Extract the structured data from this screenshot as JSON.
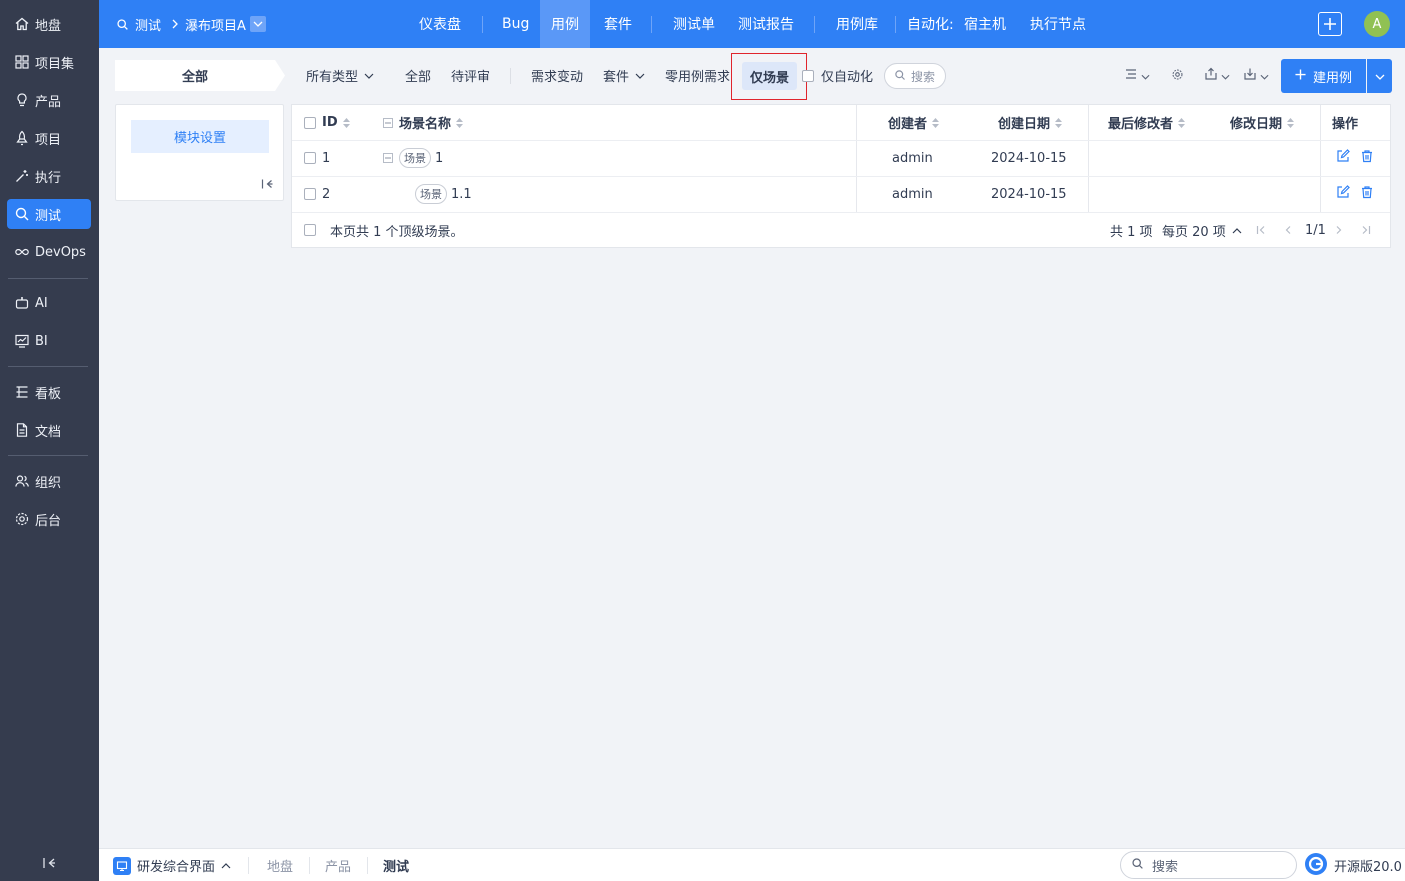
{
  "colors": {
    "primary": "#2f80f5",
    "sidebar_bg": "#353c4e",
    "highlight_border": "#e0242c",
    "avatar_bg": "#90c153"
  },
  "sidebar": {
    "items": [
      {
        "label": "地盘",
        "icon": "home-icon"
      },
      {
        "label": "项目集",
        "icon": "grid-icon"
      },
      {
        "label": "产品",
        "icon": "bulb-icon"
      },
      {
        "label": "项目",
        "icon": "rocket-icon"
      },
      {
        "label": "执行",
        "icon": "wand-icon"
      },
      {
        "label": "测试",
        "icon": "search-icon"
      },
      {
        "label": "DevOps",
        "icon": "infinity-icon"
      },
      {
        "label": "AI",
        "icon": "robot-icon"
      },
      {
        "label": "BI",
        "icon": "chart-icon"
      },
      {
        "label": "看板",
        "icon": "board-icon"
      },
      {
        "label": "文档",
        "icon": "doc-icon"
      },
      {
        "label": "组织",
        "icon": "people-icon"
      },
      {
        "label": "后台",
        "icon": "gear-icon"
      }
    ],
    "active": "测试"
  },
  "header": {
    "module": "测试",
    "project": "瀑布项目A",
    "nav": [
      "仪表盘",
      "Bug",
      "用例",
      "套件",
      "测试单",
      "测试报告",
      "用例库",
      "自动化:",
      "宿主机",
      "执行节点"
    ],
    "active_nav": "用例",
    "avatar_letter": "A"
  },
  "toolbar": {
    "module_tab": "全部",
    "type_filter": "所有类型",
    "filters": [
      "全部",
      "待评审",
      "需求变动",
      "套件",
      "零用例需求",
      "仅场景"
    ],
    "active_filter": "仅场景",
    "auto_only": "仅自动化",
    "search": "搜索",
    "create_button": "建用例"
  },
  "module_panel": {
    "button": "模块设置"
  },
  "table": {
    "columns": [
      "ID",
      "场景名称",
      "创建者",
      "创建日期",
      "最后修改者",
      "修改日期",
      "操作"
    ],
    "rows": [
      {
        "id": "1",
        "tag": "场景",
        "name": "1",
        "creator": "admin",
        "created": "2024-10-15",
        "last_modifier": "",
        "modified": ""
      },
      {
        "id": "2",
        "tag": "场景",
        "name": "1.1",
        "creator": "admin",
        "created": "2024-10-15",
        "last_modifier": "",
        "modified": ""
      }
    ],
    "summary": "本页共 1 个顶级场景。",
    "total": "共 1 项",
    "per_page": "每页 20 项",
    "page": "1/1"
  },
  "footer": {
    "app": "研发综合界面",
    "crumbs": [
      "地盘",
      "产品",
      "测试"
    ],
    "search": "搜索",
    "version": "开源版20.0"
  }
}
